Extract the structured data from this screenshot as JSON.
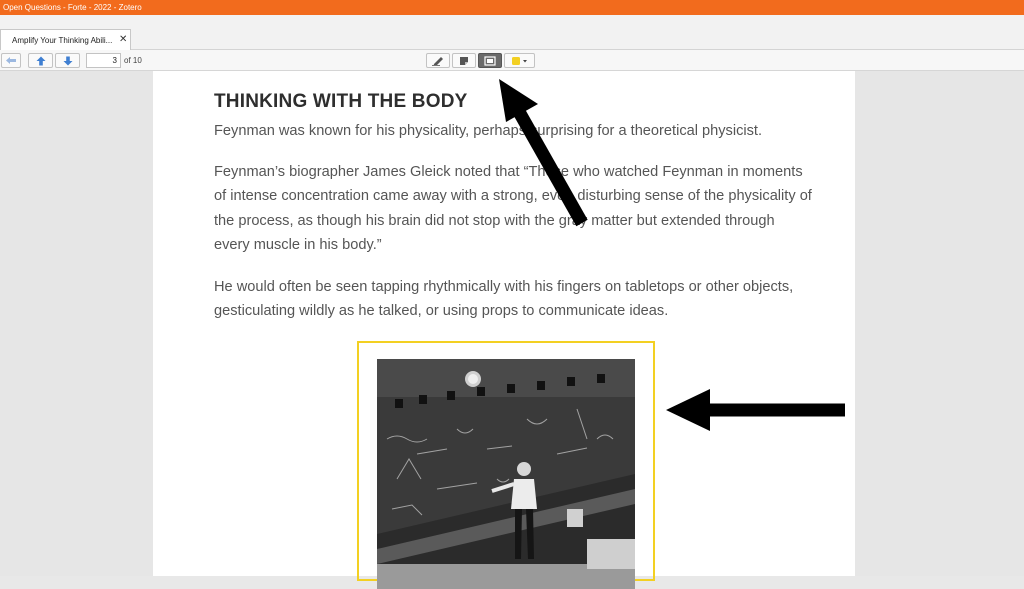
{
  "window": {
    "title": "Open Questions - Forte - 2022 - Zotero"
  },
  "tab": {
    "label": "Amplify Your Thinking Abili...",
    "close": "✕"
  },
  "toolbar": {
    "page_value": "3",
    "page_total": "of 10",
    "tools": [
      "highlight-pen",
      "note",
      "area-select",
      "color-picker"
    ],
    "highlight_color": "#f3d022"
  },
  "document": {
    "heading": "THINKING WITH THE BODY",
    "paragraphs": [
      "Feynman was known for his physicality, perhaps surprising for a theoretical physicist.",
      "Feynman’s biographer James Gleick noted that “Those who watched Feynman in moments of intense concentration came away with a strong, even disturbing sense of the physicality of the process, as though his brain did not stop with the gray matter but extended through every muscle in his body.”",
      "He would often be seen tapping rhythmically with his fingers on tabletops or other objects, gesticulating wildly as he talked, or using props to communicate ideas."
    ],
    "image_selection_color": "#f3d022"
  },
  "colors": {
    "titlebar": "#f26b1d",
    "accent_yellow": "#f3d022"
  }
}
